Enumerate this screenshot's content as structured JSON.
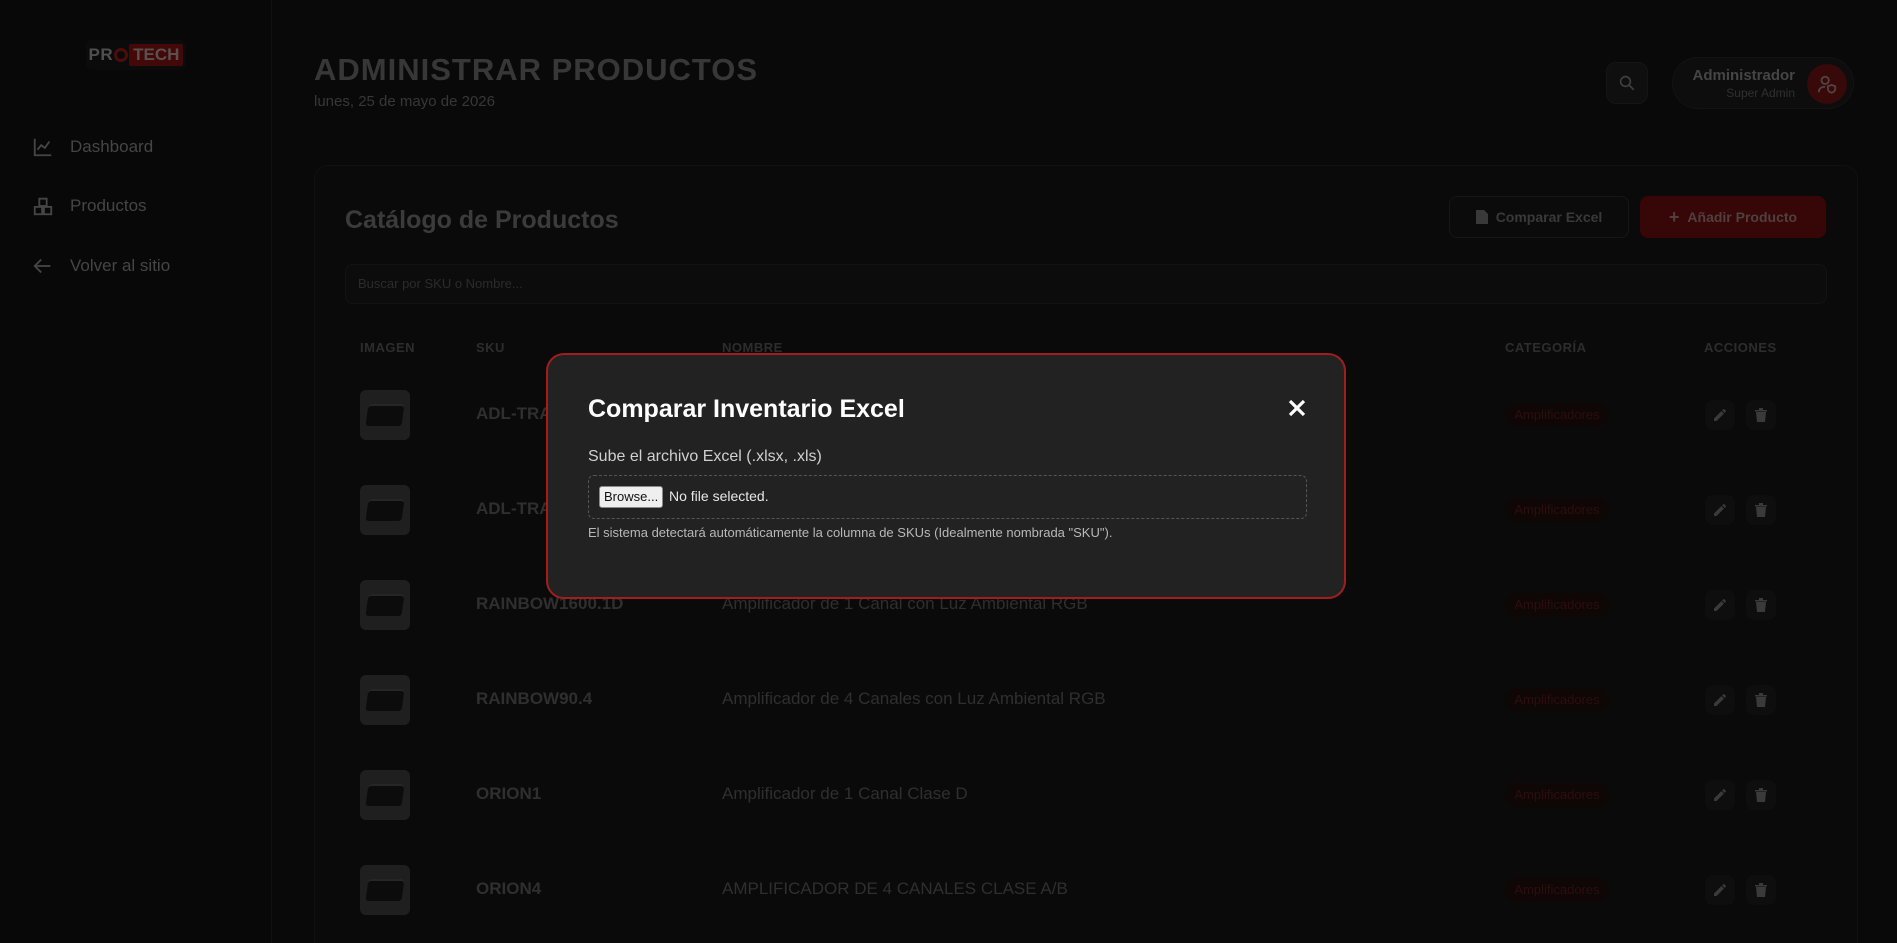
{
  "sidebar": {
    "logo": {
      "left": "PR",
      "right": "TECH"
    },
    "items": [
      {
        "label": "Dashboard",
        "icon": "chart-line-icon"
      },
      {
        "label": "Productos",
        "icon": "boxes-icon"
      },
      {
        "label": "Volver al sitio",
        "icon": "arrow-left-icon"
      }
    ]
  },
  "header": {
    "title": "ADMINISTRAR PRODUCTOS",
    "date": "lunes, 25 de mayo de 2026",
    "user": {
      "name": "Administrador",
      "role": "Super Admin"
    }
  },
  "catalog": {
    "title": "Catálogo de Productos",
    "compare_label": "Comparar Excel",
    "add_label": "Añadir Producto",
    "search_placeholder": "Buscar por SKU o Nombre...",
    "columns": [
      "IMAGEN",
      "SKU",
      "NOMBRE",
      "CATEGORÍA",
      "ACCIONES"
    ],
    "rows": [
      {
        "sku": "ADL-TRA",
        "name": "",
        "category": "Amplificadores"
      },
      {
        "sku": "ADL-TRA",
        "name": "",
        "category": "Amplificadores"
      },
      {
        "sku": "RAINBOW1600.1D",
        "name": "Amplificador de 1 Canal con Luz Ambiental RGB",
        "category": "Amplificadores"
      },
      {
        "sku": "RAINBOW90.4",
        "name": "Amplificador de 4 Canales con Luz Ambiental RGB",
        "category": "Amplificadores"
      },
      {
        "sku": "ORION1",
        "name": "Amplificador de 1 Canal Clase D",
        "category": "Amplificadores"
      },
      {
        "sku": "ORION4",
        "name": "AMPLIFICADOR DE 4 CANALES CLASE A/B",
        "category": "Amplificadores"
      }
    ]
  },
  "modal": {
    "title": "Comparar Inventario Excel",
    "label": "Sube el archivo Excel (.xlsx, .xls)",
    "browse_label": "Browse...",
    "file_status": "No file selected.",
    "hint": "El sistema detectará automáticamente la columna de SKUs (Idealmente nombrada \"SKU\")."
  },
  "colors": {
    "accent": "#a11e1e",
    "modal_bg": "#222222"
  }
}
